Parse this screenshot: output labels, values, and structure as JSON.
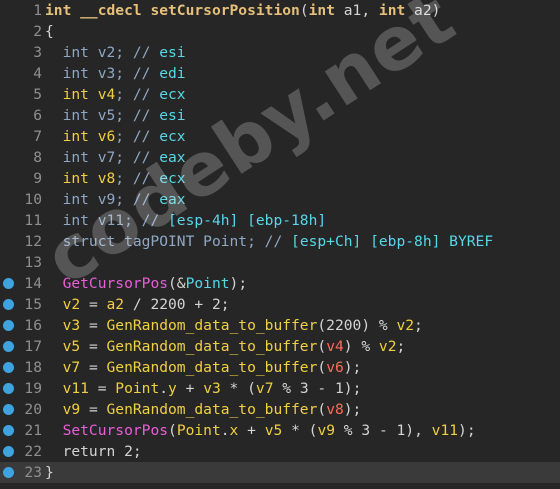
{
  "editor": {
    "lines": [
      {
        "n": "1",
        "bp": false,
        "tokens": [
          [
            "int",
            "kwb"
          ],
          [
            " __cdecl ",
            "kwb"
          ],
          [
            "setCursorPosition",
            "kwb"
          ],
          [
            "(",
            "tx"
          ],
          [
            "int",
            "kwb"
          ],
          [
            " a1, ",
            "tx"
          ],
          [
            "int",
            "kwb"
          ],
          [
            " a2)",
            "tx"
          ]
        ]
      },
      {
        "n": "2",
        "bp": false,
        "tokens": [
          [
            "{",
            "tx"
          ]
        ]
      },
      {
        "n": "3",
        "bp": false,
        "tokens": [
          [
            "  int ",
            "bl"
          ],
          [
            "v2",
            "bl"
          ],
          [
            "; // ",
            "bl"
          ],
          [
            "esi",
            "reg"
          ]
        ]
      },
      {
        "n": "4",
        "bp": false,
        "tokens": [
          [
            "  int ",
            "bl"
          ],
          [
            "v3",
            "bl"
          ],
          [
            "; // ",
            "bl"
          ],
          [
            "edi",
            "reg"
          ]
        ]
      },
      {
        "n": "5",
        "bp": false,
        "tokens": [
          [
            "  int ",
            "yel"
          ],
          [
            "v4",
            "yel"
          ],
          [
            "; // ",
            "bl"
          ],
          [
            "ecx",
            "reg"
          ]
        ]
      },
      {
        "n": "6",
        "bp": false,
        "tokens": [
          [
            "  int ",
            "bl"
          ],
          [
            "v5",
            "bl"
          ],
          [
            "; // ",
            "bl"
          ],
          [
            "esi",
            "reg"
          ]
        ]
      },
      {
        "n": "7",
        "bp": false,
        "tokens": [
          [
            "  int ",
            "yel"
          ],
          [
            "v6",
            "yel"
          ],
          [
            "; // ",
            "bl"
          ],
          [
            "ecx",
            "reg"
          ]
        ]
      },
      {
        "n": "8",
        "bp": false,
        "tokens": [
          [
            "  int ",
            "bl"
          ],
          [
            "v7",
            "bl"
          ],
          [
            "; // ",
            "bl"
          ],
          [
            "eax",
            "reg"
          ]
        ]
      },
      {
        "n": "9",
        "bp": false,
        "tokens": [
          [
            "  int ",
            "yel"
          ],
          [
            "v8",
            "yel"
          ],
          [
            "; // ",
            "bl"
          ],
          [
            "ecx",
            "reg"
          ]
        ]
      },
      {
        "n": "10",
        "bp": false,
        "tokens": [
          [
            "  int ",
            "bl"
          ],
          [
            "v9",
            "bl"
          ],
          [
            "; // ",
            "bl"
          ],
          [
            "eax",
            "reg"
          ]
        ]
      },
      {
        "n": "11",
        "bp": false,
        "tokens": [
          [
            "  int ",
            "bl"
          ],
          [
            "v11",
            "bl"
          ],
          [
            "; // ",
            "bl"
          ],
          [
            "[esp-4h] [ebp-18h]",
            "reg"
          ]
        ]
      },
      {
        "n": "12",
        "bp": false,
        "tokens": [
          [
            "  struct tagPOINT ",
            "bl"
          ],
          [
            "Point",
            "bl"
          ],
          [
            "; // ",
            "bl"
          ],
          [
            "[esp+Ch] [ebp-8h] BYREF",
            "reg"
          ]
        ]
      },
      {
        "n": "13",
        "bp": false,
        "tokens": [
          [
            "",
            "tx"
          ]
        ]
      },
      {
        "n": "14",
        "bp": true,
        "tokens": [
          [
            "  ",
            "tx"
          ],
          [
            "GetCursorPos",
            "pk"
          ],
          [
            "(&",
            "tx"
          ],
          [
            "Point",
            "reg"
          ],
          [
            ");",
            "tx"
          ]
        ]
      },
      {
        "n": "15",
        "bp": true,
        "tokens": [
          [
            "  ",
            "tx"
          ],
          [
            "v2",
            "yel"
          ],
          [
            " = ",
            "tx"
          ],
          [
            "a2",
            "yel"
          ],
          [
            " / 2200 + 2;",
            "tx"
          ]
        ]
      },
      {
        "n": "16",
        "bp": true,
        "tokens": [
          [
            "  ",
            "tx"
          ],
          [
            "v3",
            "yel"
          ],
          [
            " = ",
            "tx"
          ],
          [
            "GenRandom_data_to_buffer",
            "yel"
          ],
          [
            "(2200) % ",
            "tx"
          ],
          [
            "v2",
            "yel"
          ],
          [
            ";",
            "tx"
          ]
        ]
      },
      {
        "n": "17",
        "bp": true,
        "tokens": [
          [
            "  ",
            "tx"
          ],
          [
            "v5",
            "yel"
          ],
          [
            " = ",
            "tx"
          ],
          [
            "GenRandom_data_to_buffer",
            "yel"
          ],
          [
            "(",
            "tx"
          ],
          [
            "v4",
            "red"
          ],
          [
            ") % ",
            "tx"
          ],
          [
            "v2",
            "yel"
          ],
          [
            ";",
            "tx"
          ]
        ]
      },
      {
        "n": "18",
        "bp": true,
        "tokens": [
          [
            "  ",
            "tx"
          ],
          [
            "v7",
            "yel"
          ],
          [
            " = ",
            "tx"
          ],
          [
            "GenRandom_data_to_buffer",
            "yel"
          ],
          [
            "(",
            "tx"
          ],
          [
            "v6",
            "red"
          ],
          [
            ");",
            "tx"
          ]
        ]
      },
      {
        "n": "19",
        "bp": true,
        "tokens": [
          [
            "  ",
            "tx"
          ],
          [
            "v11",
            "yel"
          ],
          [
            " = ",
            "tx"
          ],
          [
            "Point",
            "yel"
          ],
          [
            ".",
            "tx"
          ],
          [
            "y",
            "yel"
          ],
          [
            " + ",
            "tx"
          ],
          [
            "v3",
            "yel"
          ],
          [
            " * (",
            "tx"
          ],
          [
            "v7",
            "yel"
          ],
          [
            " % 3 - 1);",
            "tx"
          ]
        ]
      },
      {
        "n": "20",
        "bp": true,
        "tokens": [
          [
            "  ",
            "tx"
          ],
          [
            "v9",
            "yel"
          ],
          [
            " = ",
            "tx"
          ],
          [
            "GenRandom_data_to_buffer",
            "yel"
          ],
          [
            "(",
            "tx"
          ],
          [
            "v8",
            "red"
          ],
          [
            ");",
            "tx"
          ]
        ]
      },
      {
        "n": "21",
        "bp": true,
        "tokens": [
          [
            "  ",
            "tx"
          ],
          [
            "SetCursorPos",
            "pk"
          ],
          [
            "(",
            "tx"
          ],
          [
            "Point",
            "yel"
          ],
          [
            ".",
            "tx"
          ],
          [
            "x",
            "yel"
          ],
          [
            " + ",
            "tx"
          ],
          [
            "v5",
            "yel"
          ],
          [
            " * (",
            "tx"
          ],
          [
            "v9",
            "yel"
          ],
          [
            " % 3 - 1), ",
            "tx"
          ],
          [
            "v11",
            "yel"
          ],
          [
            ");",
            "tx"
          ]
        ]
      },
      {
        "n": "22",
        "bp": true,
        "tokens": [
          [
            "  return 2;",
            "tx"
          ]
        ]
      },
      {
        "n": "23",
        "bp": true,
        "tokens": [
          [
            "}",
            "tx"
          ]
        ]
      }
    ],
    "current_line": "23"
  },
  "watermark": "codeby.net",
  "colors": {
    "background": "#262626",
    "line_number": "#8f8f8f",
    "breakpoint": "#3ea3de",
    "keyword": "#e6c07b",
    "register_comment": "#57d7e7",
    "declaration": "#8fa7c4",
    "api_call": "#e95fd7",
    "variable": "#f0d040",
    "uninitialized_var": "#ff6a5a"
  }
}
